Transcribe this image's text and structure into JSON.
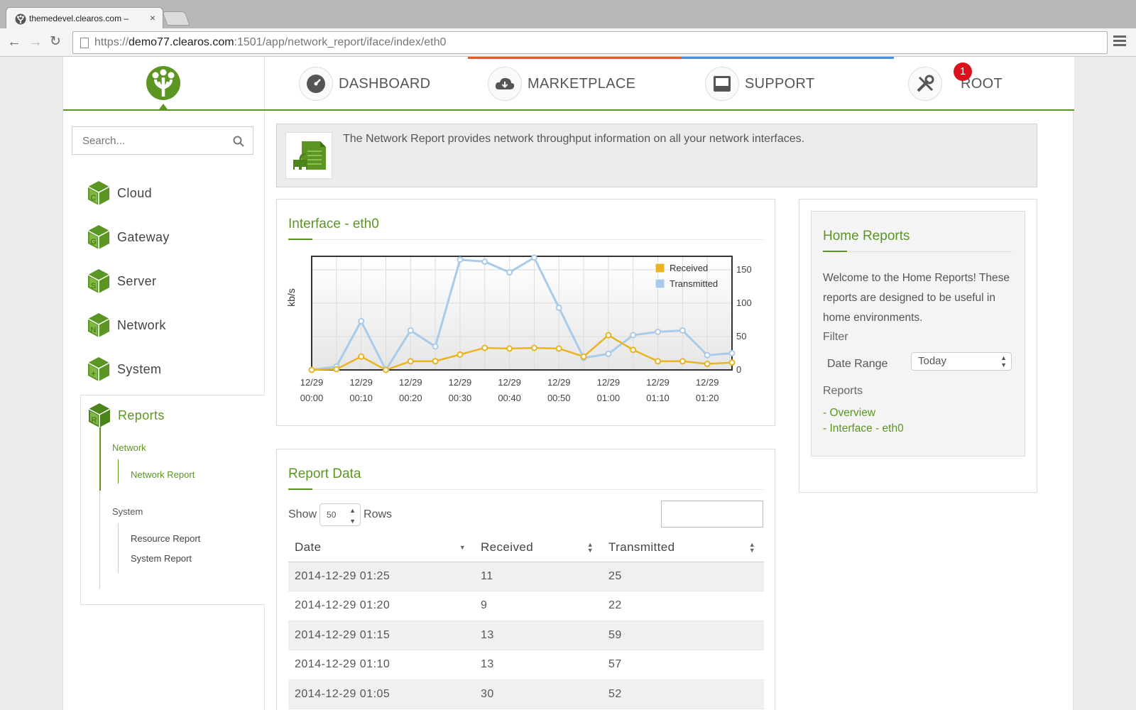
{
  "browser": {
    "tab_title": "themedevel.clearos.com –",
    "tab_close": "×",
    "url_prefix": "https://",
    "url_host": "demo77.clearos.com",
    "url_path": ":1501/app/network_report/iface/index/eth0"
  },
  "topnav": {
    "items": [
      {
        "label": "DASHBOARD",
        "icon": "gauge-icon"
      },
      {
        "label": "MARKETPLACE",
        "icon": "cloud-download-icon"
      },
      {
        "label": "SUPPORT",
        "icon": "inbox-icon"
      },
      {
        "label": "ROOT",
        "icon": "tools-icon"
      }
    ],
    "notification_count": "1"
  },
  "sidebar": {
    "search_placeholder": "Search...",
    "categories": [
      {
        "letter": "C",
        "label": "Cloud"
      },
      {
        "letter": "G",
        "label": "Gateway"
      },
      {
        "letter": "S",
        "label": "Server"
      },
      {
        "letter": "N",
        "label": "Network"
      },
      {
        "letter": "+",
        "label": "System"
      },
      {
        "letter": "R",
        "label": "Reports"
      }
    ],
    "reports_groups": [
      {
        "label": "Network",
        "items": [
          "Network Report"
        ]
      },
      {
        "label": "System",
        "items": [
          "Resource Report",
          "System Report"
        ]
      }
    ]
  },
  "info": {
    "text": "The Network Report provides network throughput information on all your network interfaces."
  },
  "chart_card": {
    "title": "Interface - eth0"
  },
  "chart_data": {
    "type": "line",
    "title": "Interface - eth0",
    "ylabel": "kb/s",
    "xlabel": "",
    "y_axis_side": "right",
    "ylim": [
      0,
      170
    ],
    "yticks": [
      0,
      50,
      100,
      150
    ],
    "x": [
      "00:00",
      "00:05",
      "00:10",
      "00:15",
      "00:20",
      "00:25",
      "00:30",
      "00:35",
      "00:40",
      "00:45",
      "00:50",
      "00:55",
      "01:00",
      "01:05",
      "01:10",
      "01:15",
      "01:20",
      "01:25"
    ],
    "xtick_labels": [
      {
        "date": "12/29",
        "time": "00:00"
      },
      {
        "date": "12/29",
        "time": "00:10"
      },
      {
        "date": "12/29",
        "time": "00:20"
      },
      {
        "date": "12/29",
        "time": "00:30"
      },
      {
        "date": "12/29",
        "time": "00:40"
      },
      {
        "date": "12/29",
        "time": "00:50"
      },
      {
        "date": "12/29",
        "time": "01:00"
      },
      {
        "date": "12/29",
        "time": "01:10"
      },
      {
        "date": "12/29",
        "time": "01:20"
      }
    ],
    "legend_position": "top-right",
    "grid": true,
    "series": [
      {
        "name": "Received",
        "color": "#e8b520",
        "values": [
          0,
          1,
          20,
          0,
          13,
          13,
          23,
          33,
          32,
          33,
          32,
          20,
          52,
          30,
          13,
          13,
          9,
          11
        ]
      },
      {
        "name": "Transmitted",
        "color": "#a9cbea",
        "values": [
          0,
          5,
          73,
          0,
          59,
          35,
          165,
          162,
          146,
          168,
          93,
          18,
          24,
          52,
          57,
          59,
          22,
          25
        ]
      }
    ]
  },
  "report_card": {
    "title": "Report Data",
    "show_label": "Show",
    "rows_value": "50",
    "rows_label": "Rows",
    "columns": [
      "Date",
      "Received",
      "Transmitted"
    ],
    "rows": [
      [
        "2014-12-29 01:25",
        "11",
        "25"
      ],
      [
        "2014-12-29 01:20",
        "9",
        "22"
      ],
      [
        "2014-12-29 01:15",
        "13",
        "59"
      ],
      [
        "2014-12-29 01:10",
        "13",
        "57"
      ],
      [
        "2014-12-29 01:05",
        "30",
        "52"
      ]
    ]
  },
  "home_reports": {
    "title": "Home Reports",
    "description": "Welcome to the Home Reports! These reports are designed to be useful in home environments.",
    "filter_heading": "Filter",
    "date_range_label": "Date Range",
    "date_range_value": "Today",
    "reports_heading": "Reports",
    "links": [
      "- Overview",
      "- Interface - eth0"
    ]
  },
  "colors": {
    "accent": "#5b9623",
    "badge": "#d9121b"
  }
}
